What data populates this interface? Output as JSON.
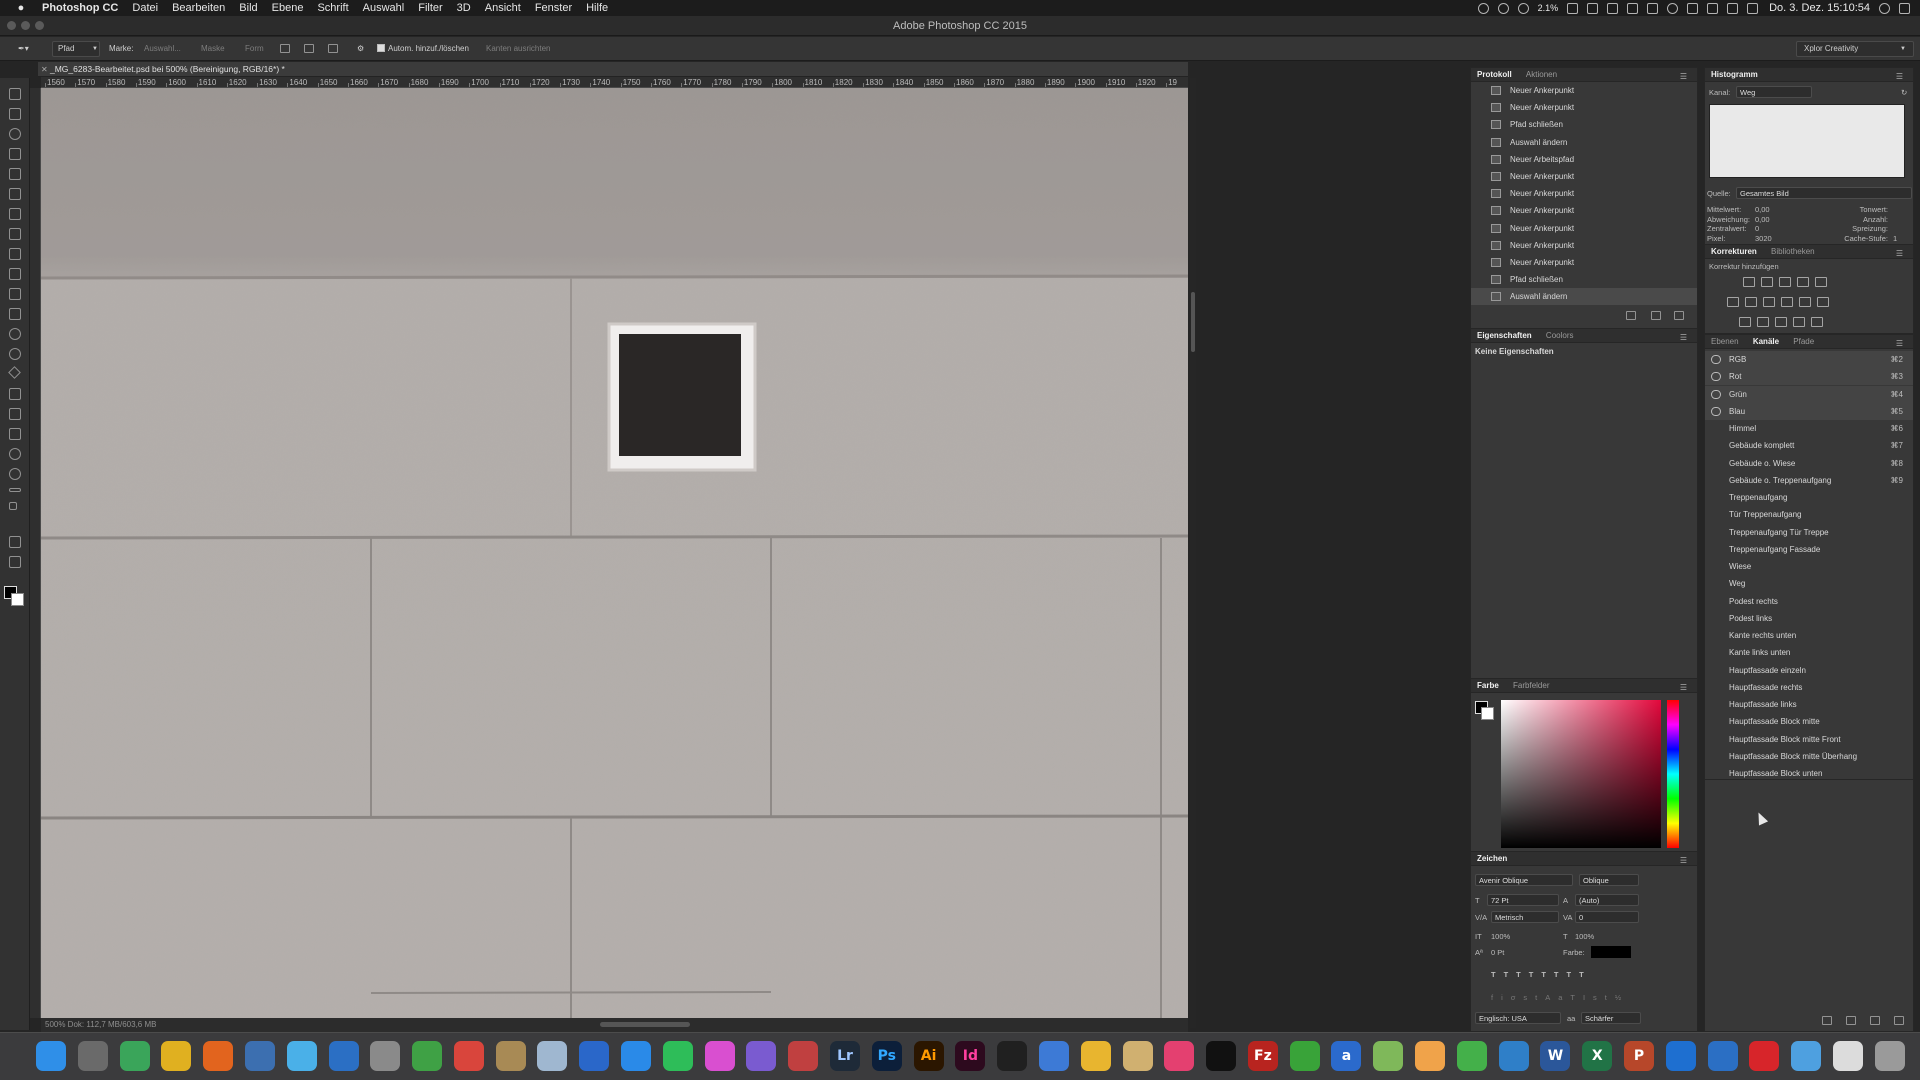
{
  "menubar": {
    "app_name": "Photoshop CC",
    "items": [
      "Datei",
      "Bearbeiten",
      "Bild",
      "Ebene",
      "Schrift",
      "Auswahl",
      "Filter",
      "3D",
      "Ansicht",
      "Fenster",
      "Hilfe"
    ],
    "cpu_label": "2.1%",
    "clock": "Do. 3. Dez.  15:10:54"
  },
  "window": {
    "title": "Adobe Photoshop CC 2015"
  },
  "options": {
    "mode": "Pfad",
    "marke_label": "Marke:",
    "auswahl": "Auswahl...",
    "maske": "Maske",
    "form": "Form",
    "auto_add": "Autom. hinzuf./löschen",
    "kanten": "Kanten ausrichten",
    "workspace": "Xplor Creativity"
  },
  "document": {
    "tab_title": "_MG_6283-Bearbeitet.psd bei 500% (Bereinigung, RGB/16*) *",
    "status": "500%     Dok: 112,7 MB/603,6 MB"
  },
  "ruler": {
    "ticks": [
      "1560",
      "1570",
      "1580",
      "1590",
      "1600",
      "1610",
      "1620",
      "1630",
      "1640",
      "1650",
      "1660",
      "1670",
      "1680",
      "1690",
      "1700",
      "1710",
      "1720",
      "1730",
      "1740",
      "1750",
      "1760",
      "1770",
      "1780",
      "1790",
      "1800",
      "1810",
      "1820",
      "1830",
      "1840",
      "1850",
      "1860",
      "1870",
      "1880",
      "1890",
      "1900",
      "1910",
      "1920",
      "19"
    ]
  },
  "history": {
    "tabs": [
      "Protokoll",
      "Aktionen"
    ],
    "items": [
      "Neuer Ankerpunkt",
      "Neuer Ankerpunkt",
      "Pfad schließen",
      "Auswahl ändern",
      "Neuer Arbeitspfad",
      "Neuer Ankerpunkt",
      "Neuer Ankerpunkt",
      "Neuer Ankerpunkt",
      "Neuer Ankerpunkt",
      "Neuer Ankerpunkt",
      "Neuer Ankerpunkt",
      "Pfad schließen",
      "Auswahl ändern"
    ]
  },
  "properties": {
    "tabs": [
      "Eigenschaften",
      "Coolors"
    ],
    "text": "Keine Eigenschaften"
  },
  "color": {
    "tabs": [
      "Farbe",
      "Farbfelder"
    ]
  },
  "character": {
    "title": "Zeichen",
    "font": "Avenir Oblique",
    "style": "Oblique",
    "size": "72 Pt",
    "leading": "(Auto)",
    "kerning": "Metrisch",
    "tracking": "0",
    "vscale": "100%",
    "hscale": "100%",
    "baseline": "0 Pt",
    "farbe_label": "Farbe:",
    "language": "Englisch: USA",
    "aa": "Schärfer"
  },
  "histogram": {
    "title": "Histogramm",
    "kanal_label": "Kanal:",
    "kanal": "Weg",
    "quelle_label": "Quelle:",
    "quelle": "Gesamtes Bild",
    "stats": [
      {
        "label": "Mittelwert:",
        "value": "0,00"
      },
      {
        "label": "Abweichung:",
        "value": "0,00"
      },
      {
        "label": "Zentralwert:",
        "value": "0"
      },
      {
        "label": "Pixel:",
        "value": "3020"
      }
    ],
    "stats_right": [
      {
        "label": "Tonwert:",
        "value": ""
      },
      {
        "label": "Anzahl:",
        "value": ""
      },
      {
        "label": "Spreizung:",
        "value": ""
      },
      {
        "label": "Cache-Stufe:",
        "value": "1"
      }
    ]
  },
  "corrections": {
    "tabs": [
      "Korrekturen",
      "Bibliotheken"
    ],
    "subtitle": "Korrektur hinzufügen"
  },
  "channels": {
    "tabs": [
      "Ebenen",
      "Kanäle",
      "Pfade"
    ],
    "items": [
      {
        "name": "RGB",
        "shortcut": "⌘2",
        "eye": true
      },
      {
        "name": "Rot",
        "shortcut": "⌘3",
        "eye": true
      },
      {
        "name": "Grün",
        "shortcut": "⌘4",
        "eye": true
      },
      {
        "name": "Blau",
        "shortcut": "⌘5",
        "eye": true
      },
      {
        "name": "Himmel",
        "shortcut": "⌘6",
        "eye": false
      },
      {
        "name": "Gebäude komplett",
        "shortcut": "⌘7",
        "eye": false
      },
      {
        "name": "Gebäude o. Wiese",
        "shortcut": "⌘8",
        "eye": false
      },
      {
        "name": "Gebäude o. Treppenaufgang",
        "shortcut": "⌘9",
        "eye": false
      },
      {
        "name": "Treppenaufgang",
        "shortcut": "",
        "eye": false
      },
      {
        "name": "Tür Treppenaufgang",
        "shortcut": "",
        "eye": false
      },
      {
        "name": "Treppenaufgang Tür Treppe",
        "shortcut": "",
        "eye": false
      },
      {
        "name": "Treppenaufgang Fassade",
        "shortcut": "",
        "eye": false
      },
      {
        "name": "Wiese",
        "shortcut": "",
        "eye": false
      },
      {
        "name": "Weg",
        "shortcut": "",
        "eye": false
      },
      {
        "name": "Podest rechts",
        "shortcut": "",
        "eye": false
      },
      {
        "name": "Podest links",
        "shortcut": "",
        "eye": false
      },
      {
        "name": "Kante rechts unten",
        "shortcut": "",
        "eye": false
      },
      {
        "name": "Kante links unten",
        "shortcut": "",
        "eye": false
      },
      {
        "name": "Hauptfassade einzeln",
        "shortcut": "",
        "eye": false
      },
      {
        "name": "Hauptfassade rechts",
        "shortcut": "",
        "eye": false
      },
      {
        "name": "Hauptfassade links",
        "shortcut": "",
        "eye": false
      },
      {
        "name": "Hauptfassade Block mitte",
        "shortcut": "",
        "eye": false
      },
      {
        "name": "Hauptfassade Block mitte Front",
        "shortcut": "",
        "eye": false
      },
      {
        "name": "Hauptfassade Block mitte Überhang",
        "shortcut": "",
        "eye": false
      },
      {
        "name": "Hauptfassade Block unten",
        "shortcut": "",
        "eye": false
      }
    ]
  },
  "dock": {
    "apps": [
      {
        "name": "finder",
        "color": "#2f8fe8",
        "label": ""
      },
      {
        "name": "launchpad",
        "color": "#6a6a6a",
        "label": ""
      },
      {
        "name": "network",
        "color": "#3aa55a",
        "label": ""
      },
      {
        "name": "chrome",
        "color": "#e0b020",
        "label": ""
      },
      {
        "name": "firefox",
        "color": "#e2641e",
        "label": ""
      },
      {
        "name": "thunderbird",
        "color": "#3c6fb0",
        "label": ""
      },
      {
        "name": "tweetbot",
        "color": "#4ab0e8",
        "label": ""
      },
      {
        "name": "1password",
        "color": "#2b6fc4",
        "label": ""
      },
      {
        "name": "notes",
        "color": "#8a8a8a",
        "label": ""
      },
      {
        "name": "evernote",
        "color": "#3fa145",
        "label": ""
      },
      {
        "name": "wunderlist",
        "color": "#d9453c",
        "label": ""
      },
      {
        "name": "contacts",
        "color": "#a88a55",
        "label": ""
      },
      {
        "name": "preview",
        "color": "#9fb7d0",
        "label": ""
      },
      {
        "name": "internet",
        "color": "#2a67c9",
        "label": ""
      },
      {
        "name": "appstore",
        "color": "#2a8ae8",
        "label": ""
      },
      {
        "name": "spotify",
        "color": "#2ebd59",
        "label": ""
      },
      {
        "name": "itunes",
        "color": "#d94fd0",
        "label": ""
      },
      {
        "name": "imovie",
        "color": "#7a5bd0",
        "label": ""
      },
      {
        "name": "pinwheel",
        "color": "#c04040",
        "label": ""
      },
      {
        "name": "lightroom",
        "color": "#1e2a38",
        "label": "Lr",
        "fg": "#9fc6ff"
      },
      {
        "name": "photoshop",
        "color": "#0c1f3a",
        "label": "Ps",
        "fg": "#31a8ff"
      },
      {
        "name": "illustrator",
        "color": "#2b1600",
        "label": "Ai",
        "fg": "#ff9a00"
      },
      {
        "name": "indesign",
        "color": "#2d0a1e",
        "label": "Id",
        "fg": "#ff3fa0"
      },
      {
        "name": "camera",
        "color": "#202020",
        "label": ""
      },
      {
        "name": "photos",
        "color": "#3d7ad6",
        "label": ""
      },
      {
        "name": "keynote",
        "color": "#e8b52f",
        "label": ""
      },
      {
        "name": "aperture",
        "color": "#d0b070",
        "label": ""
      },
      {
        "name": "speech",
        "color": "#e44070",
        "label": ""
      },
      {
        "name": "terminal",
        "color": "#111111",
        "label": ""
      },
      {
        "name": "filezilla",
        "color": "#b8241f",
        "label": "Fz",
        "fg": "#ffffff"
      },
      {
        "name": "leaf",
        "color": "#39a339",
        "label": ""
      },
      {
        "name": "amazon",
        "color": "#2b6acc",
        "label": "a",
        "fg": "#ffffff"
      },
      {
        "name": "maps",
        "color": "#7fb85a",
        "label": ""
      },
      {
        "name": "pages",
        "color": "#f0a34a",
        "label": ""
      },
      {
        "name": "numbers",
        "color": "#44b04a",
        "label": ""
      },
      {
        "name": "keynote2",
        "color": "#2f7fc8",
        "label": ""
      },
      {
        "name": "word",
        "color": "#2b579a",
        "label": "W",
        "fg": "#ffffff"
      },
      {
        "name": "excel",
        "color": "#217346",
        "label": "X",
        "fg": "#ffffff"
      },
      {
        "name": "powerpoint",
        "color": "#b7472a",
        "label": "P",
        "fg": "#ffffff"
      },
      {
        "name": "ie",
        "color": "#1e6fd0",
        "label": ""
      },
      {
        "name": "1password2",
        "color": "#2b6fc4",
        "label": ""
      },
      {
        "name": "acrobat",
        "color": "#d7252a",
        "label": ""
      },
      {
        "name": "folder",
        "color": "#4ea0e0",
        "label": ""
      },
      {
        "name": "document",
        "color": "#dcdcdc",
        "label": ""
      },
      {
        "name": "trash",
        "color": "#9a9a9a",
        "label": ""
      }
    ]
  }
}
